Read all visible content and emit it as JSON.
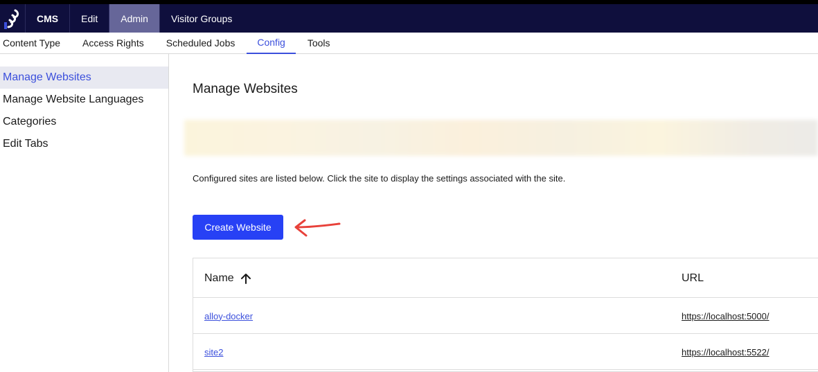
{
  "topnav": {
    "items": [
      {
        "label": "CMS",
        "bold": true
      },
      {
        "label": "Edit"
      },
      {
        "label": "Admin",
        "active": true
      },
      {
        "label": "Visitor Groups"
      }
    ]
  },
  "subnav": {
    "items": [
      "Content Type",
      "Access Rights",
      "Scheduled Jobs",
      "Config",
      "Tools"
    ],
    "active": "Config"
  },
  "sidebar": {
    "items": [
      "Manage Websites",
      "Manage Website Languages",
      "Categories",
      "Edit Tabs"
    ],
    "active": "Manage Websites"
  },
  "main": {
    "title": "Manage Websites",
    "description": "Configured sites are listed below. Click the site to display the settings associated with the site.",
    "create_button": "Create Website"
  },
  "table": {
    "columns": [
      "Name",
      "URL"
    ],
    "rows": [
      {
        "name": "alloy-docker",
        "url": "https://localhost:5000/"
      },
      {
        "name": "site2",
        "url": "https://localhost:5522/"
      }
    ]
  },
  "colors": {
    "topbar": "#0f0f3d",
    "accent": "#2741f5",
    "link": "#3b4fdc",
    "annotation_arrow": "#e8413a"
  },
  "icons": {
    "logo": "optimizely-logo-icon",
    "sort": "arrow-up-icon",
    "annotation": "red-arrow-annotation"
  }
}
